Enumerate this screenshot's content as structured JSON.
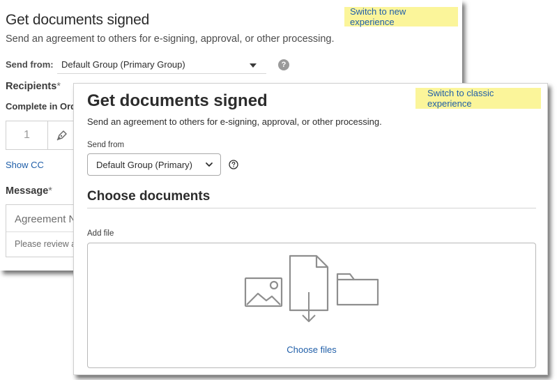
{
  "classic": {
    "title": "Get documents signed",
    "switch_label": "Switch to new experience",
    "subtitle": "Send an agreement to others for e-signing, approval, or other processing.",
    "send_from_label": "Send from:",
    "send_from_value": "Default Group (Primary Group)",
    "help_glyph": "?",
    "recipients_label": "Recipients",
    "required_mark": "*",
    "complete_in_order_label": "Complete in Ord",
    "recipient_number": "1",
    "show_cc": "Show CC",
    "message_label": "Message",
    "agreement_name_placeholder": "Agreement N",
    "message_placeholder": "Please review a"
  },
  "new": {
    "title": "Get documents signed",
    "switch_label": "Switch to classic experience",
    "subtitle": "Send an agreement to others for e-signing, approval, or other processing.",
    "send_from_label": "Send from",
    "send_from_value": "Default Group (Primary)",
    "section_title": "Choose documents",
    "add_file_label": "Add file",
    "choose_files": "Choose files"
  },
  "colors": {
    "badge_bg": "#fbf59a",
    "link": "#1f5ea8",
    "text": "#2c2c2c"
  },
  "icons": [
    "pen-icon",
    "help-icon",
    "chevron-down-icon",
    "image-icon",
    "file-download-icon",
    "folder-icon"
  ]
}
